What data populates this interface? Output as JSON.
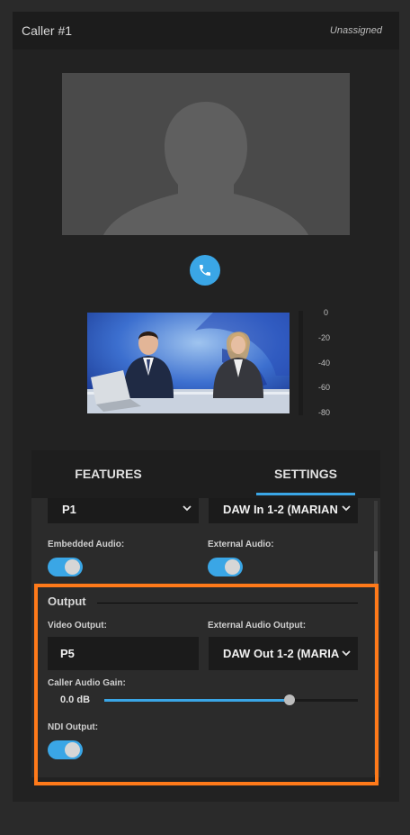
{
  "header": {
    "title": "Caller #1",
    "status": "Unassigned"
  },
  "call_button": {
    "icon": "phone-icon",
    "color": "#3aa6e6"
  },
  "audio_meter": {
    "labels": [
      "0",
      "-20",
      "-40",
      "-60",
      "-80"
    ]
  },
  "tabs": [
    {
      "label": "FEATURES",
      "active": false
    },
    {
      "label": "SETTINGS",
      "active": true
    }
  ],
  "settings": {
    "input_select": {
      "value": "P1"
    },
    "audio_input_select": {
      "value": "DAW In 1-2 (MARIAN"
    },
    "embedded_audio": {
      "label": "Embedded Audio:",
      "on": true
    },
    "external_audio": {
      "label": "External Audio:",
      "on": true
    },
    "output": {
      "title": "Output",
      "video_output": {
        "label": "Video Output:",
        "value": "P5"
      },
      "external_audio_output": {
        "label": "External Audio Output:",
        "value": "DAW Out 1-2 (MARIA"
      },
      "caller_audio_gain": {
        "label": "Caller Audio Gain:",
        "value": "0.0 dB",
        "level_fraction": 0.73
      },
      "ndi_output": {
        "label": "NDI Output:",
        "on": true
      }
    }
  },
  "colors": {
    "accent": "#3aa6e6",
    "highlight": "#ff7a1a"
  }
}
